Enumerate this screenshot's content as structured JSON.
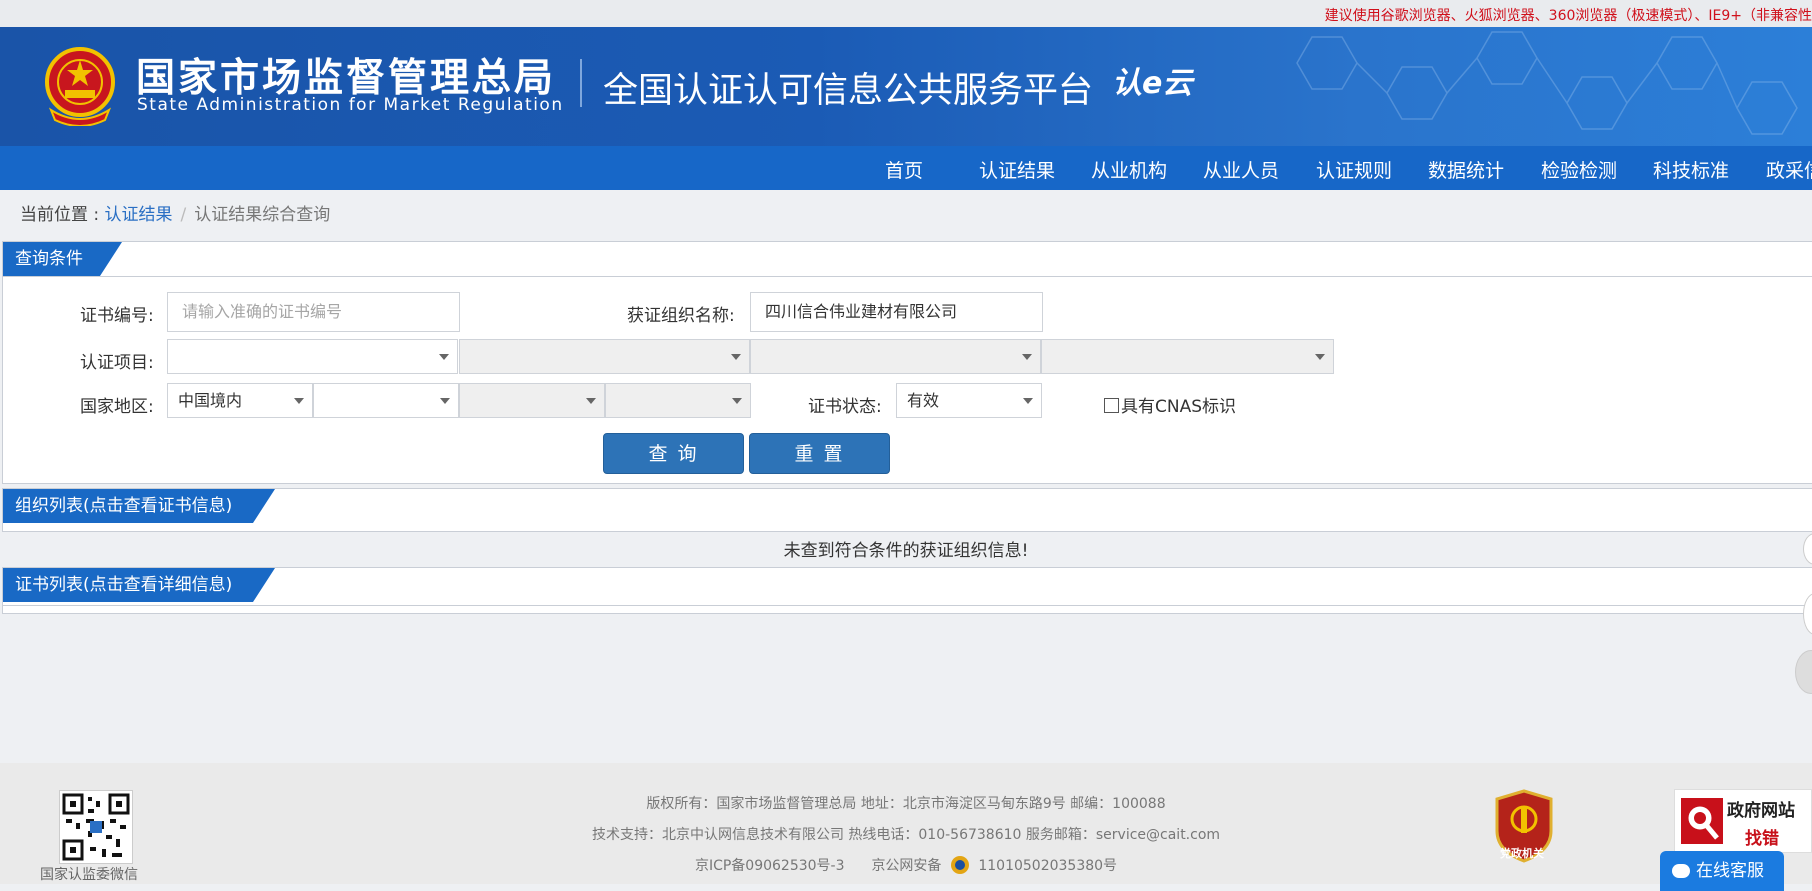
{
  "top_notice": "建议使用谷歌浏览器、火狐浏览器、360浏览器（极速模式）、IE9+（非兼容性",
  "header": {
    "org_cn": "国家市场监督管理总局",
    "org_en": "State Administration  for  Market Regulation",
    "platform": "全国认证认可信息公共服务平台",
    "logo_text": "认e云"
  },
  "nav": [
    "首页",
    "认证结果",
    "从业机构",
    "从业人员",
    "认证规则",
    "数据统计",
    "检验检测",
    "科技标准",
    "政采信"
  ],
  "breadcrumb": {
    "prefix": "当前位置 : ",
    "link": "认证结果",
    "separator": "/",
    "current": "认证结果综合查询"
  },
  "query": {
    "title": "查询条件",
    "cert_no_label": "证书编号:",
    "cert_no_placeholder": "请输入准确的证书编号",
    "org_name_label": "获证组织名称:",
    "org_name_value": "四川信合伟业建材有限公司",
    "cert_item_label": "认证项目:",
    "region_label": "国家地区:",
    "region_value": "中国境内",
    "status_label": "证书状态:",
    "status_value": "有效",
    "cnas_label": "具有CNAS标识",
    "search_button": "查 询",
    "reset_button": "重 置"
  },
  "org_list": {
    "title": "组织列表(点击查看证书信息)",
    "empty_message": "未查到符合条件的获证组织信息!"
  },
  "cert_list": {
    "title": "证书列表(点击查看详细信息)"
  },
  "footer": {
    "qr_caption": "国家认监委微信",
    "line1": "版权所有：国家市场监督管理总局    地址：北京市海淀区马甸东路9号    邮编：100088",
    "line2": "技术支持：北京中认网信息技术有限公司    热线电话：010-56738610    服务邮箱：service@cait.com",
    "icp": "京ICP备09062530号-3",
    "police_prefix": "京公网安备",
    "police_no": "11010502035380号",
    "party_badge": "党政机关",
    "gov_find_line1": "政府网站",
    "gov_find_line2": "找错",
    "chat": "在线客服"
  },
  "colors": {
    "header_blue": "#1a54a8",
    "nav_blue": "#1767c8",
    "button_blue": "#2d73b7",
    "notice_red": "#d0101b"
  }
}
